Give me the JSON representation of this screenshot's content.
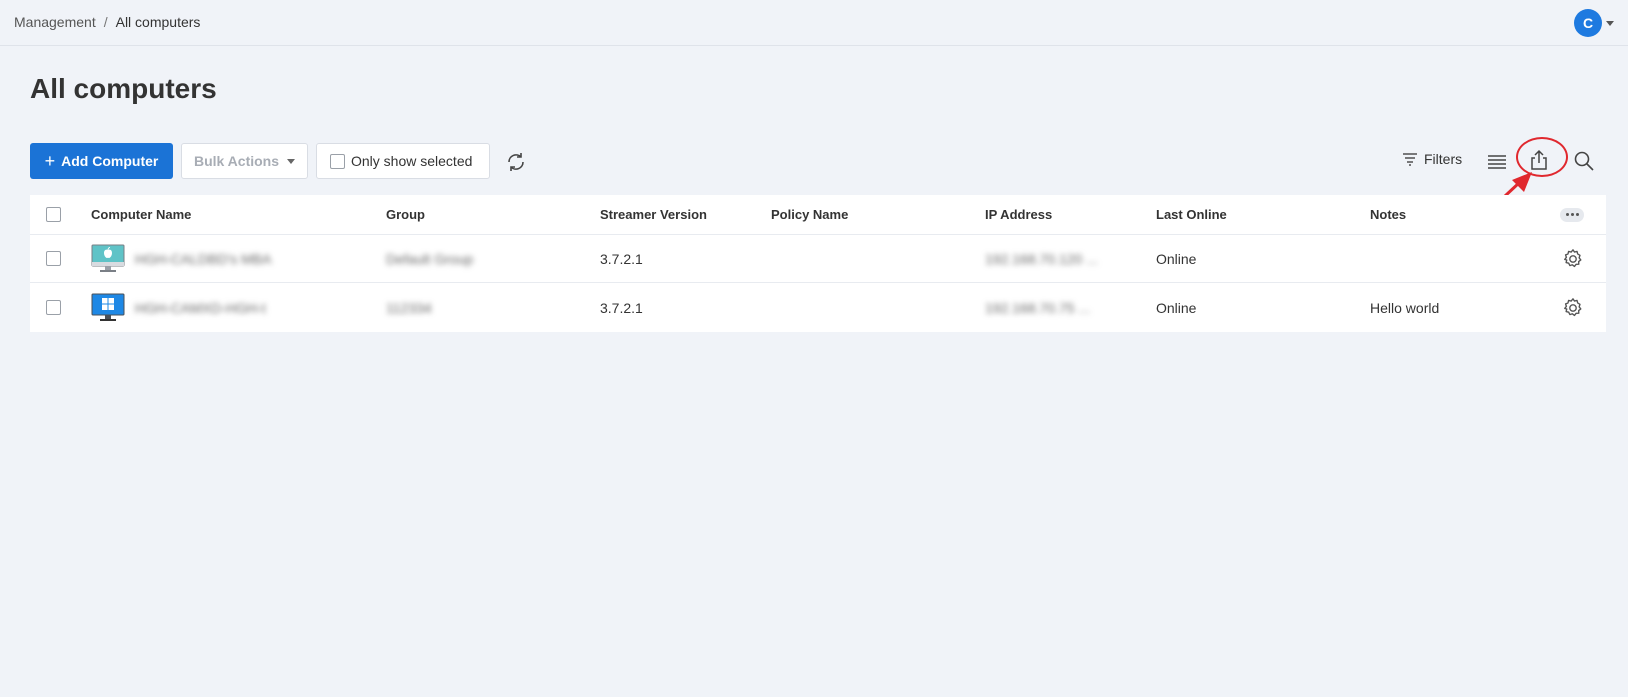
{
  "breadcrumb": {
    "parent": "Management",
    "separator": "/",
    "current": "All computers"
  },
  "user": {
    "initial": "C"
  },
  "page": {
    "title": "All computers"
  },
  "toolbar": {
    "add_label": "Add Computer",
    "bulk_label": "Bulk Actions",
    "only_selected_label": "Only show selected",
    "filters_label": "Filters"
  },
  "table": {
    "columns": [
      "Computer Name",
      "Group",
      "Streamer Version",
      "Policy Name",
      "IP Address",
      "Last Online",
      "Notes"
    ],
    "rows": [
      {
        "os": "mac-icon",
        "name": "HGH-CALDBD's MBA",
        "group": "Default Group",
        "version": "3.7.2.1",
        "policy": "",
        "ip": "192.168.70.120 ...",
        "last_online": "Online",
        "notes": ""
      },
      {
        "os": "windows-icon",
        "name": "HGH-CAMXD-HGH-t",
        "group": "112334",
        "version": "3.7.2.1",
        "policy": "",
        "ip": "192.168.70.75 ...",
        "last_online": "Online",
        "notes": "Hello world"
      }
    ]
  },
  "colors": {
    "primary": "#1b73d6",
    "annotation": "#e0282e",
    "background": "#f0f3f8"
  }
}
